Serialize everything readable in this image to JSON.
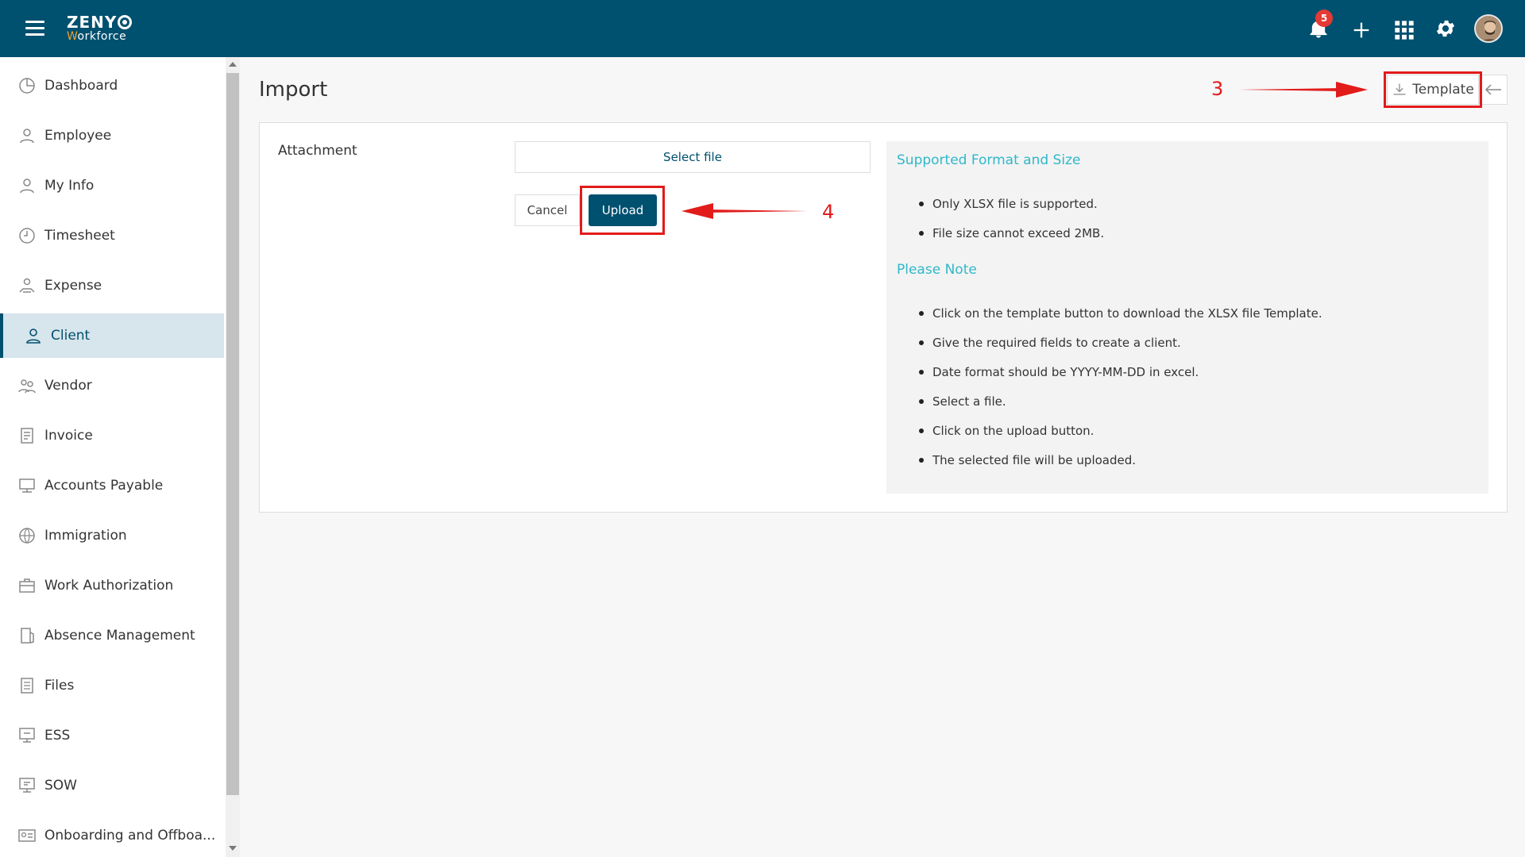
{
  "header": {
    "logo_top": "ZENY",
    "logo_w": "W",
    "logo_bottom": "orkforce",
    "notification_count": "5"
  },
  "sidebar": {
    "items": [
      {
        "label": "Dashboard",
        "icon": "dashboard-icon"
      },
      {
        "label": "Employee",
        "icon": "employee-icon"
      },
      {
        "label": "My Info",
        "icon": "my-info-icon"
      },
      {
        "label": "Timesheet",
        "icon": "clock-icon"
      },
      {
        "label": "Expense",
        "icon": "expense-icon"
      },
      {
        "label": "Client",
        "icon": "user-icon",
        "active": true
      },
      {
        "label": "Vendor",
        "icon": "vendor-icon"
      },
      {
        "label": "Invoice",
        "icon": "invoice-icon"
      },
      {
        "label": "Accounts Payable",
        "icon": "accounts-payable-icon"
      },
      {
        "label": "Immigration",
        "icon": "globe-icon"
      },
      {
        "label": "Work Authorization",
        "icon": "briefcase-icon"
      },
      {
        "label": "Absence Management",
        "icon": "door-icon"
      },
      {
        "label": "Files",
        "icon": "file-icon"
      },
      {
        "label": "ESS",
        "icon": "ess-icon"
      },
      {
        "label": "SOW",
        "icon": "sow-icon"
      },
      {
        "label": "Onboarding and Offboa...",
        "icon": "id-card-icon"
      }
    ]
  },
  "main": {
    "title": "Import",
    "template_label": "Template",
    "attachment_label": "Attachment",
    "select_file_label": "Select file",
    "cancel_label": "Cancel",
    "upload_label": "Upload",
    "supported_heading": "Supported Format and Size",
    "supported_items": [
      "Only XLSX file is supported.",
      "File size cannot exceed 2MB."
    ],
    "note_heading": "Please Note",
    "note_items": [
      "Click on the template button to download the XLSX file Template.",
      "Give the required fields to create a client.",
      "Date format should be YYYY-MM-DD in excel.",
      "Select a file.",
      "Click on the upload button.",
      "The selected file will be uploaded."
    ]
  },
  "annotations": {
    "step_template": "3",
    "step_upload": "4",
    "color": "#e21b1b"
  },
  "colors": {
    "header_bg": "#00506f",
    "accent_text": "#2fb8c9",
    "active_nav_bg": "#d7e5ec"
  }
}
